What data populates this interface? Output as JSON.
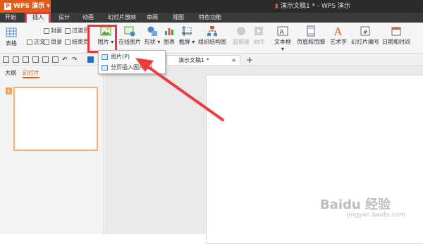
{
  "app": {
    "name": "WPS 演示",
    "window_title": "演示文稿1 * - WPS 演示"
  },
  "menu_tabs": [
    {
      "label": "开始"
    },
    {
      "label": "插入"
    },
    {
      "label": "设计"
    },
    {
      "label": "动画"
    },
    {
      "label": "幻灯片放映"
    },
    {
      "label": "审阅"
    },
    {
      "label": "视图"
    },
    {
      "label": "特色功能"
    }
  ],
  "active_menu_tab": "插入",
  "ribbon": {
    "table": "表格",
    "body": "正文",
    "cover": "封面",
    "toc": "目录",
    "transition": "过渡页",
    "ending": "结束页",
    "picture": "图片",
    "online_picture": "在线图片",
    "shape": "形状",
    "chart": "图表",
    "screenshot": "截屏",
    "org_chart": "组织结构图",
    "hyperlink": "超链接",
    "action": "动作",
    "textbox": "文本框",
    "header_footer": "页眉和页脚",
    "wordart": "艺术字",
    "slide_number": "幻灯片编号",
    "datetime": "日期和时间"
  },
  "dropdown": {
    "items": [
      {
        "label": "图片(P)"
      },
      {
        "label": "分页插入图片(S)"
      }
    ]
  },
  "doc_tab": {
    "label": "演示文稿1 *",
    "close": "×"
  },
  "new_tab": "+",
  "left_pane": {
    "tabs": [
      "大纲",
      "幻灯片"
    ],
    "active": "幻灯片",
    "slide_number": "1"
  },
  "watermark": {
    "text": "Baidu 经验",
    "sub": "jingyan.baidu.com"
  },
  "colors": {
    "accent": "#e25b1a",
    "highlight": "#e8383d",
    "arrow": "#ee3a3f"
  }
}
